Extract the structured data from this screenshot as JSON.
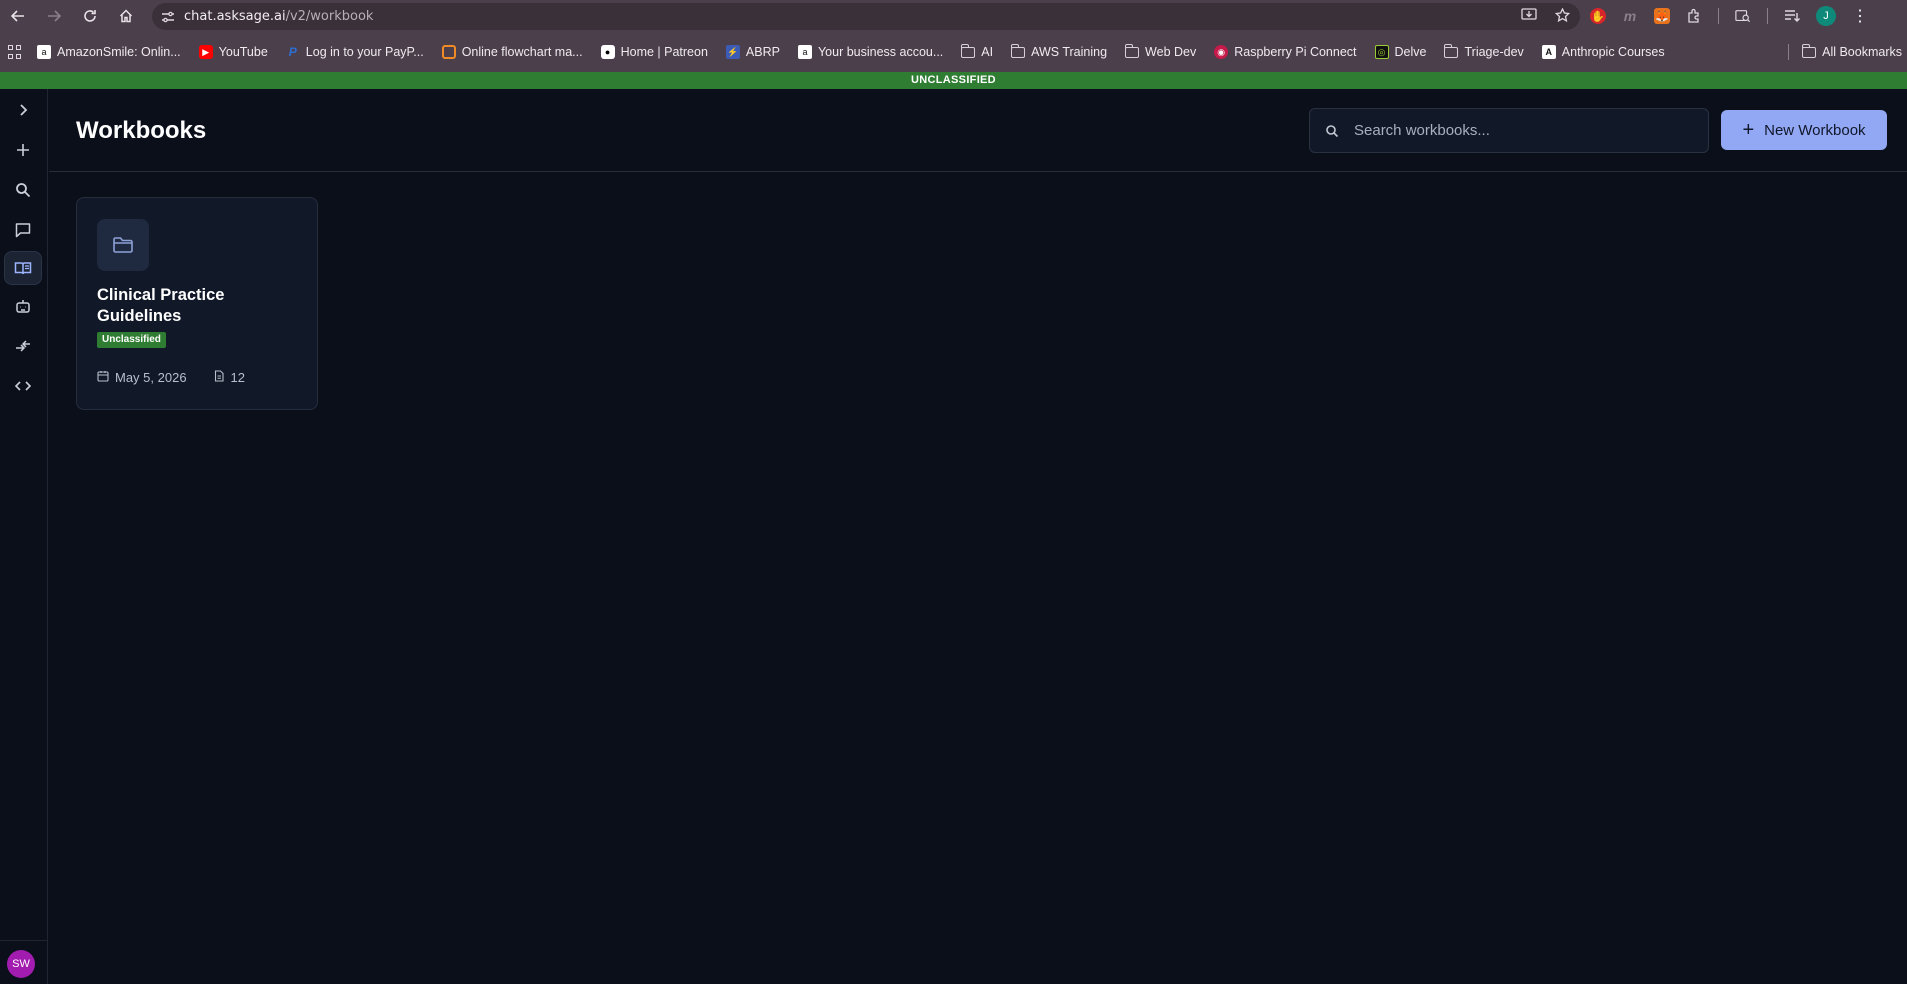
{
  "browser": {
    "url_host": "chat.asksage.ai",
    "url_path": "/v2/workbook",
    "profile_initial": "J"
  },
  "bookmarks": [
    {
      "label": "AmazonSmile: Onlin...",
      "icon": "amazon-icon"
    },
    {
      "label": "YouTube",
      "icon": "youtube-icon"
    },
    {
      "label": "Log in to your PayP...",
      "icon": "paypal-icon"
    },
    {
      "label": "Online flowchart ma...",
      "icon": "flowchart-icon"
    },
    {
      "label": "Home | Patreon",
      "icon": "patreon-icon"
    },
    {
      "label": "ABRP",
      "icon": "abrp-icon"
    },
    {
      "label": "Your business accou...",
      "icon": "amazon-icon"
    },
    {
      "label": "AI",
      "icon": "folder-icon"
    },
    {
      "label": "AWS Training",
      "icon": "folder-icon"
    },
    {
      "label": "Web Dev",
      "icon": "folder-icon"
    },
    {
      "label": "Raspberry Pi Connect",
      "icon": "raspberry-icon"
    },
    {
      "label": "Delve",
      "icon": "delve-icon"
    },
    {
      "label": "Triage-dev",
      "icon": "folder-icon"
    },
    {
      "label": "Anthropic Courses",
      "icon": "anthropic-icon"
    }
  ],
  "all_bookmarks_label": "All Bookmarks",
  "classification_banner": "UNCLASSIFIED",
  "header": {
    "title": "Workbooks",
    "search_placeholder": "Search workbooks...",
    "new_button_label": "New Workbook"
  },
  "sidebar": {
    "items": [
      "expand-icon",
      "plus-icon",
      "search-icon",
      "chat-icon",
      "workbook-icon",
      "bot-icon",
      "compare-icon",
      "code-icon"
    ],
    "active": "workbook-icon",
    "avatar_initials": "SW"
  },
  "workbooks": [
    {
      "title": "Clinical Practice Guidelines",
      "classification": "Unclassified",
      "date": "May 5, 2026",
      "file_count": "12"
    }
  ],
  "colors": {
    "banner": "#2f7d32",
    "accent_button": "#93a8f4",
    "background": "#0b0f1a"
  }
}
